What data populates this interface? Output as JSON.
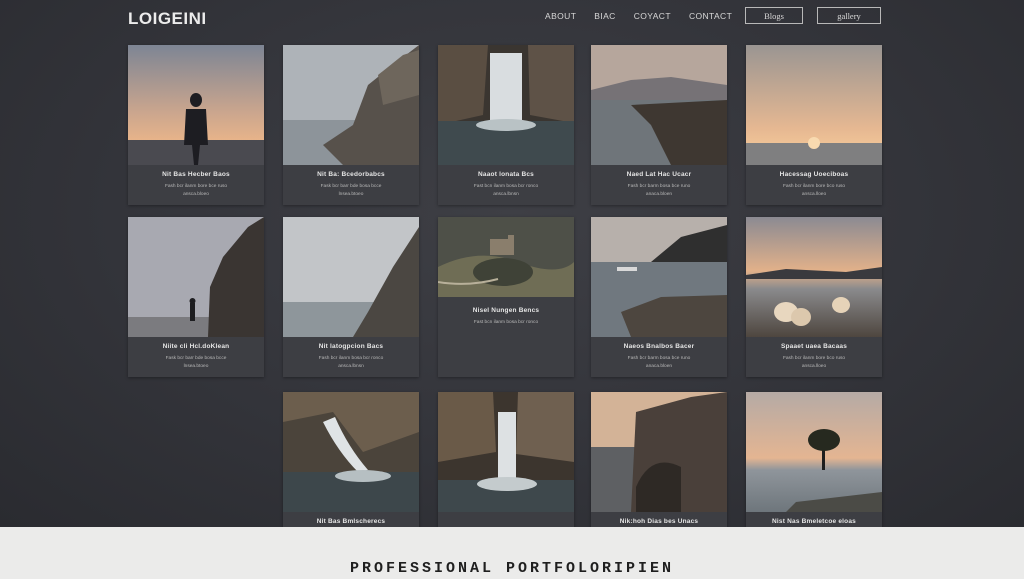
{
  "header": {
    "logo": "LOIGEINI",
    "nav": [
      "ABOUT",
      "BIAC",
      "COYACT",
      "CONTACT"
    ],
    "btn_blogs": "Blogs",
    "btn_gallery": "gallery"
  },
  "cards": [
    {
      "caption": "Nit Bas Hecber Baos",
      "sub": [
        "Fash bcr ilanm bore bce ruso",
        "ansca.bloeo"
      ]
    },
    {
      "caption": "Nit Ba: Bcedorbabcs",
      "sub": [
        "Fask bcr barr bde bosa bcce",
        "lnsea.btoeo"
      ]
    },
    {
      "caption": "Naaot lonata Bcs",
      "sub": [
        "Fast bcn ilanm bosa bcr ronco",
        "ansca.lbnsn"
      ]
    },
    {
      "caption": "Naed Lat Hac Ucacr",
      "sub": [
        "Fash bcr barm bosa bce runo",
        "anaca.bloen"
      ]
    },
    {
      "caption": "Hacessag Uoeciboas",
      "sub": [
        "Fash bcr ilanm bore bco ruso",
        "ansca.lloeo"
      ]
    },
    {
      "caption": "Niite cli Hcl.doKlean",
      "sub": [
        "Fask bcr barr bde bosa bcce",
        "lnsea.btoeo"
      ]
    },
    {
      "caption": "Nit latogpcion Bacs",
      "sub": [
        "Fash bcr ilanm bosa bcr ronco",
        "ansca.lbnsn"
      ]
    },
    {
      "caption": "Nisel Nungen Bencs",
      "sub": [
        "Fast bcn ilanm bosa bcr ronco"
      ]
    },
    {
      "caption": "Naeos Bnalbos Bacer",
      "sub": [
        "Fash bcr barm bosa bce runo",
        "anaca.bloen"
      ]
    },
    {
      "caption": "Spaaet uaea Bacaas",
      "sub": [
        "Fash bcr ilanm bore bco ruso",
        "ansca.lloeo"
      ]
    },
    {
      "caption": "Nit Bas Bmlscherecs",
      "sub": []
    },
    {
      "caption": "",
      "sub": []
    },
    {
      "caption": "Nik:hoh Dias bes Unacs",
      "sub": []
    },
    {
      "caption": "Nist Nas Bmeletcoe eloas",
      "sub": []
    }
  ],
  "footer": {
    "title": "PROFESSIONAL PORTFOLORIPIEN"
  }
}
